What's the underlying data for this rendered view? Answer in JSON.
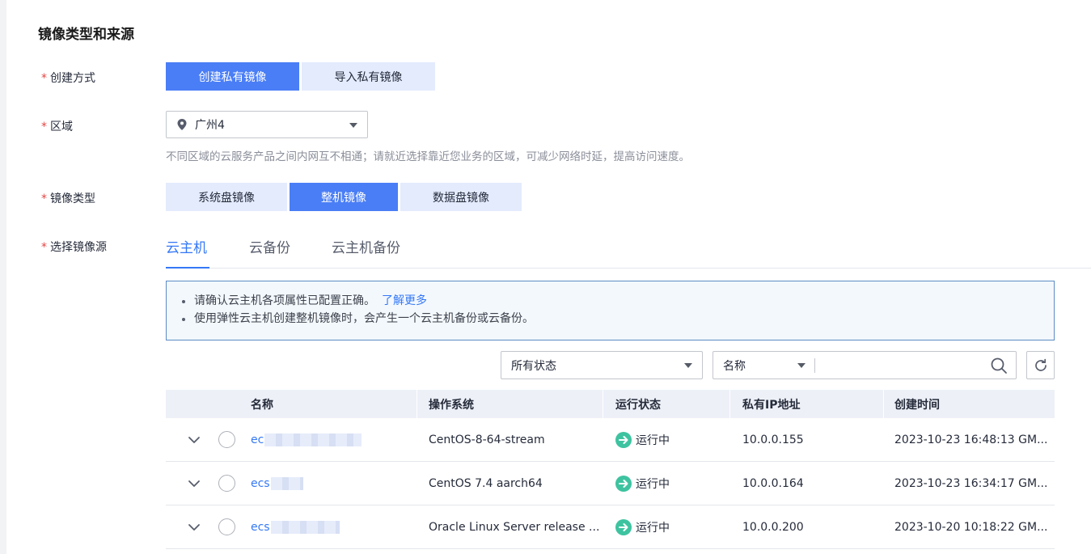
{
  "section_title": "镜像类型和来源",
  "required_mark": "*",
  "create_method": {
    "label": "创建方式",
    "options": [
      "创建私有镜像",
      "导入私有镜像"
    ],
    "selected": "创建私有镜像"
  },
  "region": {
    "label": "区域",
    "value": "广州4",
    "hint": "不同区域的云服务产品之间内网互不相通；请就近选择靠近您业务的区域，可减少网络时延，提高访问速度。"
  },
  "image_type": {
    "label": "镜像类型",
    "options": [
      "系统盘镜像",
      "整机镜像",
      "数据盘镜像"
    ],
    "selected": "整机镜像"
  },
  "image_source": {
    "label": "选择镜像源",
    "tabs": [
      "云主机",
      "云备份",
      "云主机备份"
    ],
    "active_tab": "云主机"
  },
  "notice": {
    "line1": "请确认云主机各项属性已配置正确。",
    "line1_link": "了解更多",
    "line2": "使用弹性云主机创建整机镜像时，会产生一个云主机备份或云备份。"
  },
  "filters": {
    "status": "所有状态",
    "search_field": "名称",
    "search_value": ""
  },
  "table": {
    "columns": [
      "名称",
      "操作系统",
      "运行状态",
      "私有IP地址",
      "创建时间"
    ],
    "rows": [
      {
        "name": "ec",
        "os": "CentOS-8-64-stream",
        "status": "运行中",
        "ip": "10.0.0.155",
        "created": "2023-10-23 16:48:13 GM..."
      },
      {
        "name": "ecs",
        "os": "CentOS 7.4 aarch64",
        "status": "运行中",
        "ip": "10.0.0.164",
        "created": "2023-10-23 16:34:17 GM..."
      },
      {
        "name": "ecs",
        "os": "Oracle Linux Server release ...",
        "status": "运行中",
        "ip": "10.0.0.200",
        "created": "2023-10-20 10:18:22 GM..."
      }
    ]
  },
  "colors": {
    "accent": "#4a7ef6",
    "link": "#3478f6",
    "required": "#e54545",
    "status_running": "#3ec3a0"
  }
}
